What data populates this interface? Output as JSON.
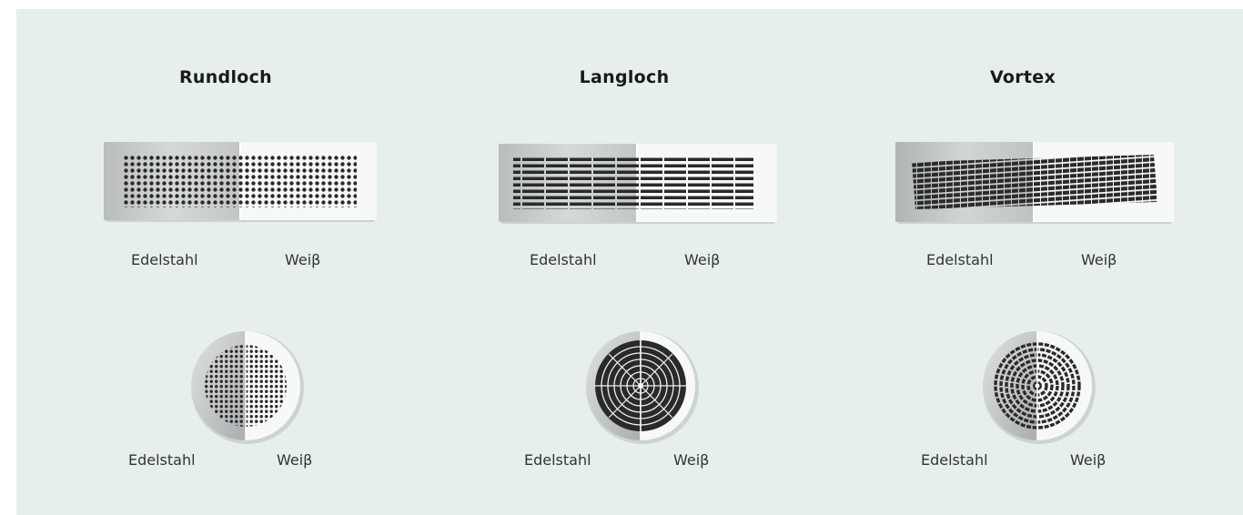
{
  "columns": [
    {
      "title": "Rundloch",
      "rect_labels": [
        "Edelstahl",
        "Weiβ"
      ],
      "round_labels": [
        "Edelstahl",
        "Weiβ"
      ]
    },
    {
      "title": "Langloch",
      "rect_labels": [
        "Edelstahl",
        "Weiβ"
      ],
      "round_labels": [
        "Edelstahl",
        "Weiβ"
      ]
    },
    {
      "title": "Vortex",
      "rect_labels": [
        "Edelstahl",
        "Weiβ"
      ],
      "round_labels": [
        "Edelstahl",
        "Weiβ"
      ]
    }
  ],
  "colors": {
    "panel": "#e6efec",
    "steel": "#c9cccc",
    "white": "#f7f8f8",
    "hole": "#2a2a2a"
  }
}
